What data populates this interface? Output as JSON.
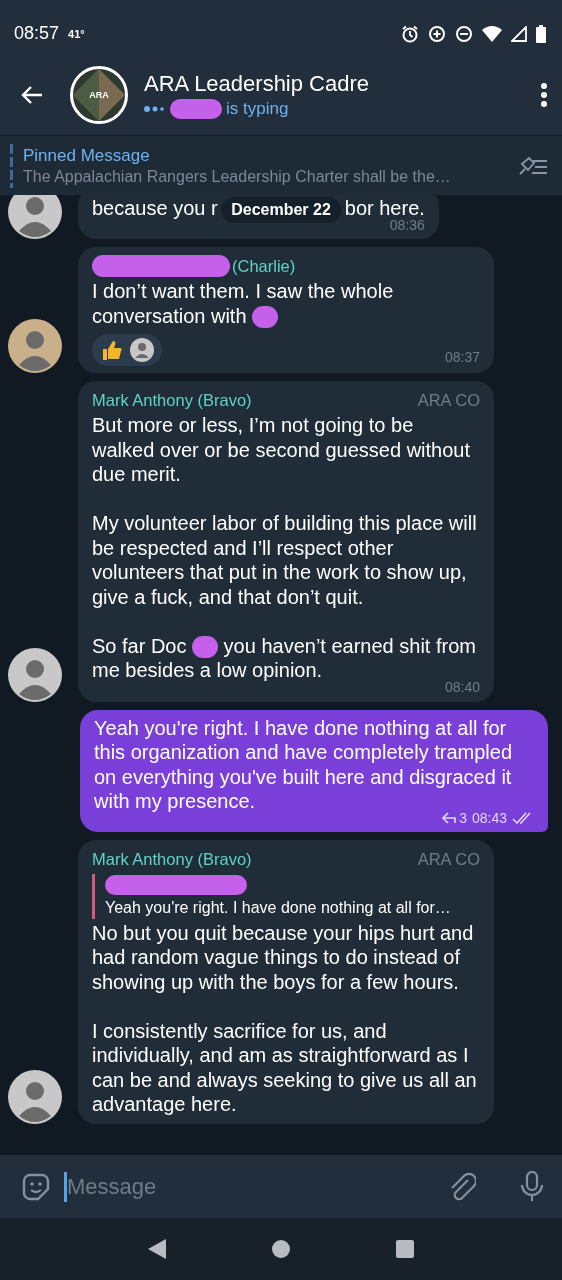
{
  "status_bar": {
    "time": "08:57",
    "temperature": "41°"
  },
  "header": {
    "avatar_text": "ARA",
    "title": "ARA Leadership Cadre",
    "typing": "is typing"
  },
  "pinned": {
    "label": "Pinned Message",
    "text": "The Appalachian Rangers Leadership Charter shall be the…"
  },
  "date_badge": "December 22",
  "messages": [
    {
      "kind": "incoming",
      "paragraphs": [
        [
          {
            "kind": "text",
            "text": "because you r"
          },
          {
            "kind": "gap"
          },
          {
            "kind": "text",
            "text": "bor here."
          }
        ]
      ],
      "time": "08:36"
    },
    {
      "kind": "incoming",
      "sender": "(Charlie)",
      "sender_redacted": true,
      "paragraphs": [
        [
          {
            "kind": "text",
            "text": "I don’t want them. I saw the whole"
          },
          {
            "kind": "text",
            "text": "conversation with"
          },
          {
            "kind": "redaction"
          }
        ]
      ],
      "reactions": [
        {
          "kind": "thumbs-up"
        },
        {
          "kind": "avatar"
        }
      ],
      "time": "08:37"
    },
    {
      "kind": "incoming",
      "sender": "Mark Anthony (Bravo)",
      "badge": "ARA CO",
      "paragraphs": [
        [
          {
            "kind": "text",
            "text": "But more or less, I’m not going to be walked over or be second guessed without due merit."
          }
        ],
        [
          {
            "kind": "text",
            "text": "My volunteer labor of building this place will be respected and I’ll respect other volunteers that put in the work to show up, give a fuck, and that don’t quit."
          }
        ],
        [
          {
            "kind": "text",
            "text": "So far Doc"
          },
          {
            "kind": "redaction"
          },
          {
            "kind": "text",
            "text": "you haven’t earned shit from"
          },
          {
            "kind": "text",
            "text": "me besides a low opinion."
          }
        ]
      ],
      "time": "08:40"
    },
    {
      "kind": "outgoing",
      "paragraphs": [
        [
          {
            "kind": "text",
            "text": "Yeah you're right. I have done nothing at all for this organization and have completely trampled on everything you've built here and disgraced it with my presence."
          }
        ]
      ],
      "replies": "3",
      "time": "08:43",
      "read": true
    },
    {
      "kind": "incoming",
      "sender": "Mark Anthony (Bravo)",
      "badge": "ARA CO",
      "quote": {
        "sender_redacted": true,
        "text": "Yeah you're right. I have done nothing at all for…"
      },
      "paragraphs": [
        [
          {
            "kind": "text",
            "text": "No but you quit because your hips hurt and had random vague things to do instead of showing up with the boys for a few hours."
          }
        ],
        [
          {
            "kind": "text",
            "text": "I consistently sacrifice for us, and individually, and am as straightforward as I can be and always seeking to give us all an advantage here."
          }
        ]
      ]
    }
  ],
  "composer": {
    "placeholder": "Message"
  }
}
